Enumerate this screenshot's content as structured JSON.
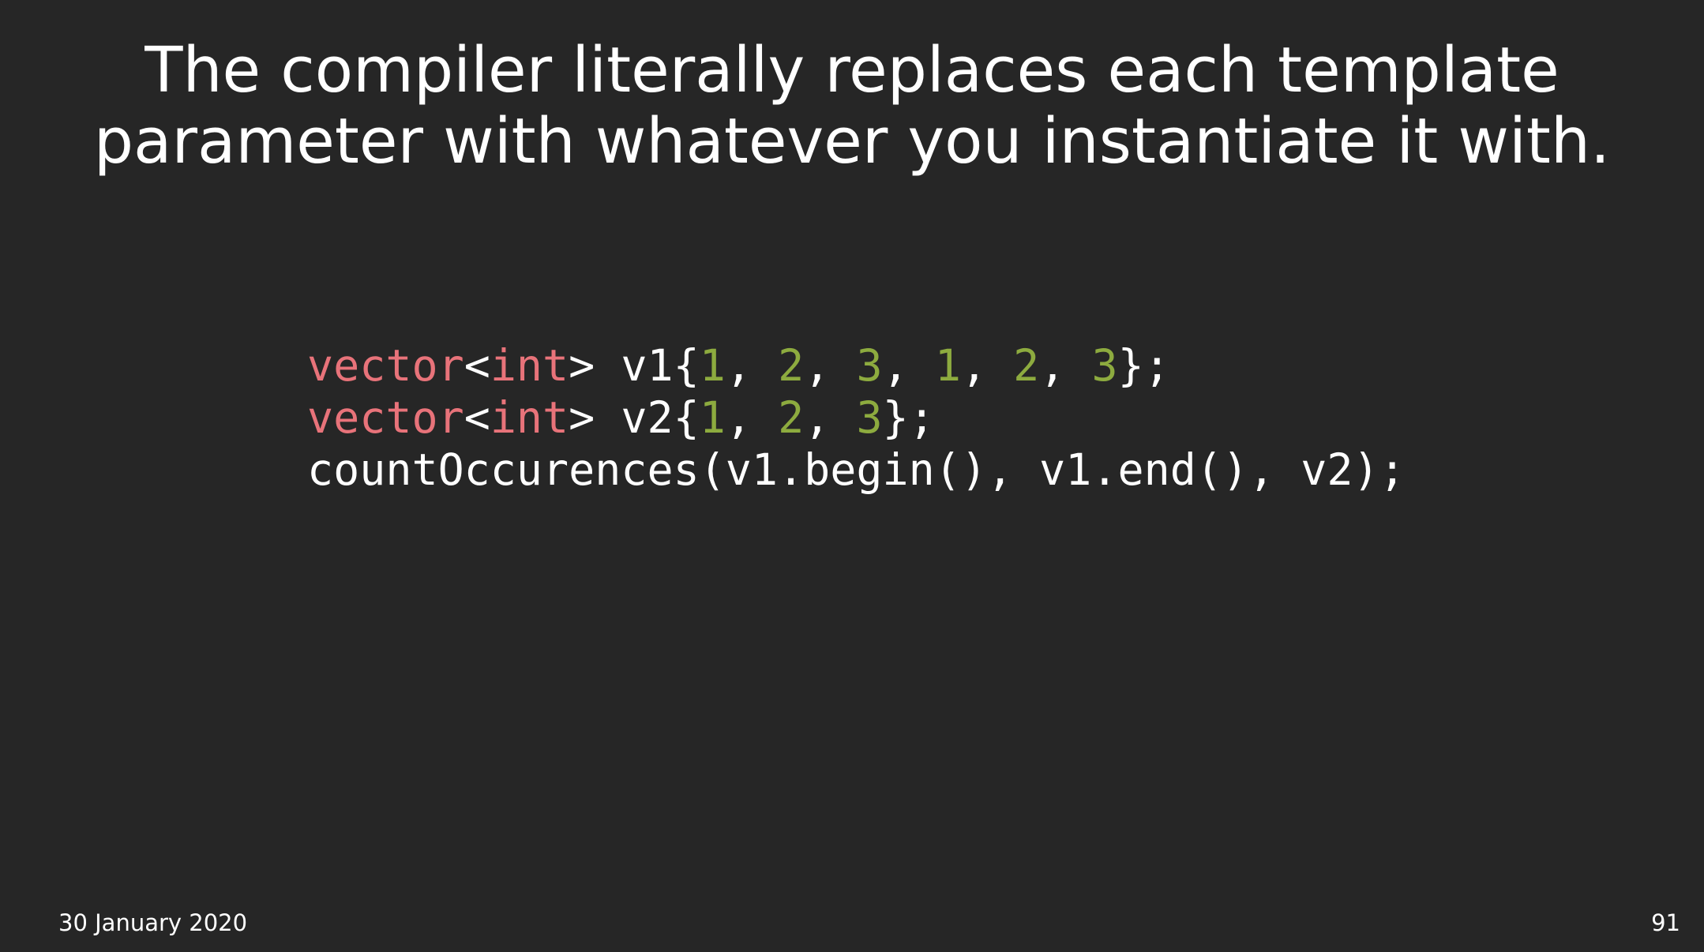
{
  "slide": {
    "title_line_1": "The compiler literally replaces each template",
    "title_line_2": "parameter with whatever you instantiate it with.",
    "code_lines": [
      [
        {
          "type": "keyword",
          "text": "vector"
        },
        {
          "type": "plain",
          "text": "<"
        },
        {
          "type": "keyword",
          "text": "int"
        },
        {
          "type": "plain",
          "text": "> v1{"
        },
        {
          "type": "number",
          "text": "1"
        },
        {
          "type": "plain",
          "text": ", "
        },
        {
          "type": "number",
          "text": "2"
        },
        {
          "type": "plain",
          "text": ", "
        },
        {
          "type": "number",
          "text": "3"
        },
        {
          "type": "plain",
          "text": ", "
        },
        {
          "type": "number",
          "text": "1"
        },
        {
          "type": "plain",
          "text": ", "
        },
        {
          "type": "number",
          "text": "2"
        },
        {
          "type": "plain",
          "text": ", "
        },
        {
          "type": "number",
          "text": "3"
        },
        {
          "type": "plain",
          "text": "};"
        }
      ],
      [
        {
          "type": "keyword",
          "text": "vector"
        },
        {
          "type": "plain",
          "text": "<"
        },
        {
          "type": "keyword",
          "text": "int"
        },
        {
          "type": "plain",
          "text": "> v2{"
        },
        {
          "type": "number",
          "text": "1"
        },
        {
          "type": "plain",
          "text": ", "
        },
        {
          "type": "number",
          "text": "2"
        },
        {
          "type": "plain",
          "text": ", "
        },
        {
          "type": "number",
          "text": "3"
        },
        {
          "type": "plain",
          "text": "};"
        }
      ],
      [
        {
          "type": "plain",
          "text": "countOccurences(v1.begin(), v1.end(), v2);"
        }
      ]
    ],
    "date": "30 January 2020",
    "page_number": "91"
  },
  "colors": {
    "background": "#262626",
    "text": "#ffffff",
    "keyword": "#e8737a",
    "number": "#8dab3f"
  }
}
